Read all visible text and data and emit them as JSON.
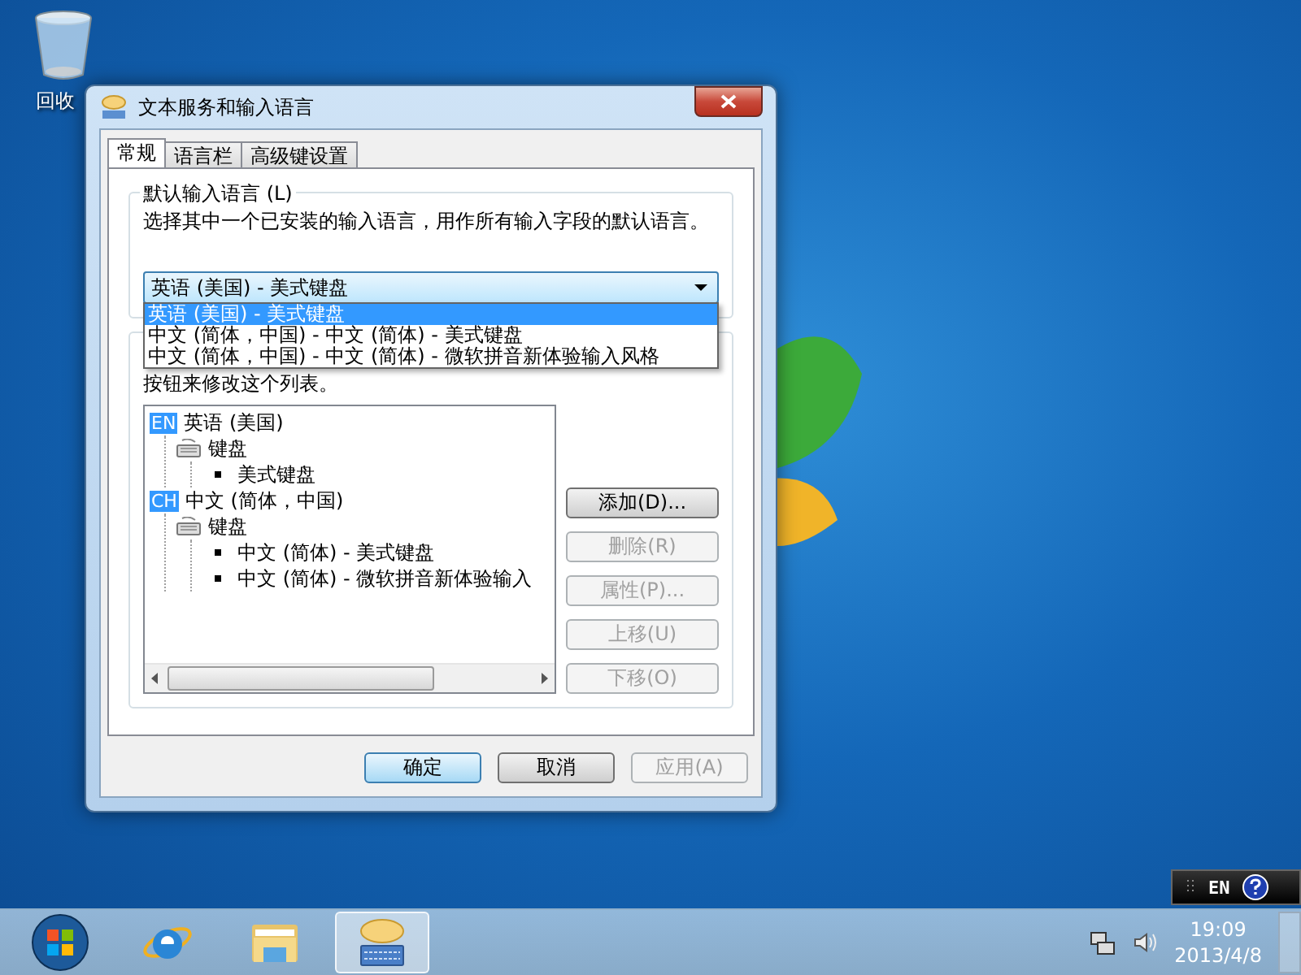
{
  "desktop": {
    "icons": [
      {
        "label": "回收"
      }
    ]
  },
  "dialog": {
    "title": "文本服务和输入语言",
    "tabs": [
      {
        "label": "常规",
        "selected": true
      },
      {
        "label": "语言栏",
        "selected": false
      },
      {
        "label": "高级键设置",
        "selected": false
      }
    ],
    "default_language": {
      "group_label": "默认输入语言 (L)",
      "description": "选择其中一个已安装的输入语言，用作所有输入字段的默认语言。",
      "combo": {
        "value": "英语 (美国) - 美式键盘",
        "expanded": true,
        "options": [
          {
            "label": "英语 (美国) - 美式键盘",
            "selected": true
          },
          {
            "label": "中文 (简体，中国) - 中文 (简体) - 美式键盘",
            "selected": false
          },
          {
            "label": "中文 (简体，中国) - 中文 (简体) - 微软拼音新体验输入风格",
            "selected": false
          }
        ]
      }
    },
    "installed_services": {
      "description_lines": [
        "按钮来修改这个列表。"
      ],
      "tree": [
        {
          "kind": "language",
          "badge": "EN",
          "label": "英语 (美国)",
          "children": [
            {
              "kind": "category",
              "label": "键盘",
              "children": [
                {
                  "kind": "service",
                  "label": "美式键盘"
                }
              ]
            }
          ]
        },
        {
          "kind": "language",
          "badge": "CH",
          "label": "中文 (简体，中国)",
          "children": [
            {
              "kind": "category",
              "label": "键盘",
              "children": [
                {
                  "kind": "service",
                  "label": "中文 (简体) - 美式键盘"
                },
                {
                  "kind": "service",
                  "label": "中文 (简体) - 微软拼音新体验输入"
                }
              ]
            }
          ]
        }
      ],
      "buttons": [
        {
          "label": "添加(D)...",
          "disabled": false
        },
        {
          "label": "删除(R)",
          "disabled": true
        },
        {
          "label": "属性(P)...",
          "disabled": true
        },
        {
          "label": "上移(U)",
          "disabled": true
        },
        {
          "label": "下移(O)",
          "disabled": true
        }
      ]
    },
    "footer_buttons": [
      {
        "label": "确定",
        "disabled": false,
        "default": true
      },
      {
        "label": "取消",
        "disabled": false,
        "default": false
      },
      {
        "label": "应用(A)",
        "disabled": true,
        "default": false
      }
    ]
  },
  "language_bar": {
    "code": "EN"
  },
  "taskbar": {
    "apps": [
      {
        "kind": "start",
        "active": false
      },
      {
        "kind": "ie",
        "active": false
      },
      {
        "kind": "explorer",
        "active": false
      },
      {
        "kind": "keyboard",
        "active": true
      }
    ],
    "clock": {
      "time": "19:09",
      "date": "2013/4/8"
    }
  }
}
